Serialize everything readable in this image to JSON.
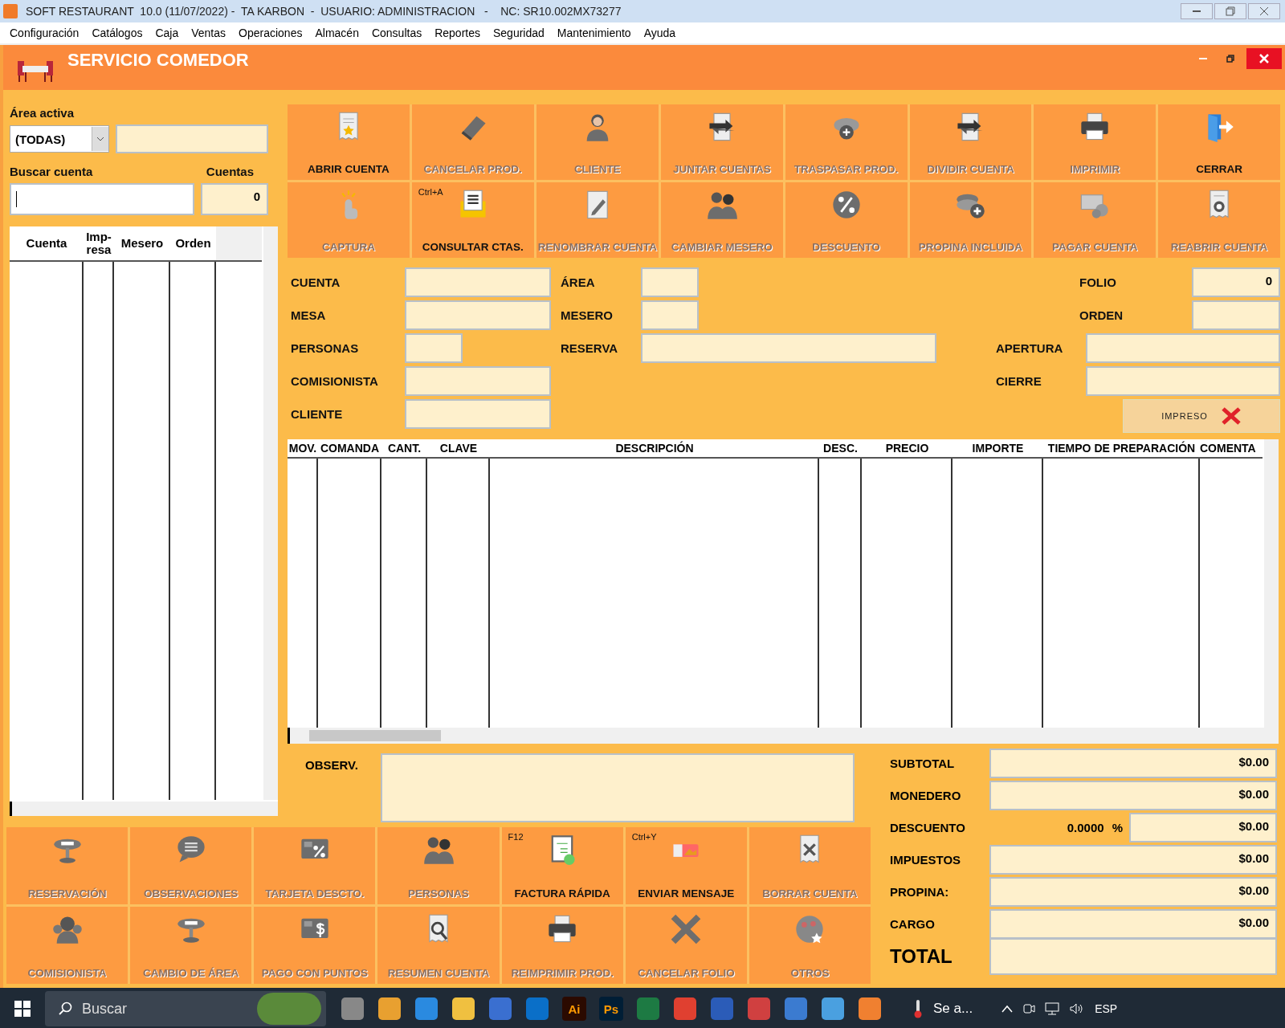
{
  "window": {
    "title": "SOFT RESTAURANT  10.0 (11/07/2022) -  TA KARBON  -  USUARIO: ADMINISTRACION   -    NC: SR10.002MX73277"
  },
  "menu": [
    "Configuración",
    "Catálogos",
    "Caja",
    "Ventas",
    "Operaciones",
    "Almacén",
    "Consultas",
    "Reportes",
    "Seguridad",
    "Mantenimiento",
    "Ayuda"
  ],
  "form_window": {
    "title": "SERVICIO COMEDOR"
  },
  "left_panel": {
    "area_label": "Área activa",
    "area_value": "(TODAS)",
    "search_label": "Buscar cuenta",
    "count_label": "Cuentas",
    "count_value": "0",
    "columns": [
      "Cuenta",
      "Imp-resa",
      "Mesero",
      "Orden"
    ]
  },
  "toolbar": [
    {
      "label": "ABRIR CUENTA",
      "disabled": false
    },
    {
      "label": "CANCELAR PROD.",
      "disabled": true
    },
    {
      "label": "CLIENTE",
      "disabled": true
    },
    {
      "label": "JUNTAR CUENTAS",
      "disabled": true
    },
    {
      "label": "TRASPASAR PROD.",
      "disabled": true
    },
    {
      "label": "DIVIDIR CUENTA",
      "disabled": true
    },
    {
      "label": "IMPRIMIR",
      "disabled": true
    },
    {
      "label": "CERRAR",
      "disabled": false
    },
    {
      "label": "CAPTURA",
      "disabled": true
    },
    {
      "label": "CONSULTAR CTAS.",
      "disabled": false,
      "shortcut": "Ctrl+A"
    },
    {
      "label": "RENOMBRAR CUENTA",
      "disabled": true
    },
    {
      "label": "CAMBIAR MESERO",
      "disabled": true
    },
    {
      "label": "DESCUENTO",
      "disabled": true
    },
    {
      "label": "PROPINA INCLUIDA",
      "disabled": true
    },
    {
      "label": "PAGAR CUENTA",
      "disabled": true
    },
    {
      "label": "REABRIR CUENTA",
      "disabled": true
    }
  ],
  "form": {
    "left_fields": [
      {
        "label": "CUENTA"
      },
      {
        "label": "MESA"
      },
      {
        "label": "PERSONAS"
      },
      {
        "label": "COMISIONISTA"
      },
      {
        "label": "CLIENTE"
      }
    ],
    "middle_fields": [
      {
        "label": "ÁREA"
      },
      {
        "label": "MESERO"
      },
      {
        "label": "RESERVA"
      }
    ],
    "right_fields": [
      {
        "label": "FOLIO",
        "value": "0"
      },
      {
        "label": "ORDEN"
      },
      {
        "label": "APERTURA"
      },
      {
        "label": "CIERRE"
      }
    ],
    "printed_button": {
      "label": "IMPRESO",
      "checked": false
    }
  },
  "table": {
    "columns": [
      "MOV.",
      "COMANDA",
      "CANT.",
      "CLAVE",
      "DESCRIPCIÓN",
      "DESC.",
      "PRECIO",
      "IMPORTE",
      "TIEMPO DE PREPARACIÓN",
      "COMENTA"
    ]
  },
  "observations": {
    "label": "OBSERV."
  },
  "totals": [
    {
      "label": "SUBTOTAL",
      "value": "$0.00"
    },
    {
      "label": "MONEDERO",
      "value": "$0.00"
    },
    {
      "label": "DESCUENTO",
      "value": "$0.00",
      "percent": "0.0000",
      "percent_sign": "%"
    },
    {
      "label": "IMPUESTOS",
      "value": "$0.00"
    },
    {
      "label": "PROPINA:",
      "value": "$0.00"
    },
    {
      "label": "CARGO",
      "value": "$0.00"
    },
    {
      "label": "TOTAL",
      "kind": "grand"
    }
  ],
  "bottom_buttons": [
    {
      "label": "RESERVACIÓN",
      "disabled": true
    },
    {
      "label": "OBSERVACIONES",
      "disabled": true
    },
    {
      "label": "TARJETA DESCTO.",
      "disabled": true
    },
    {
      "label": "PERSONAS",
      "disabled": true
    },
    {
      "label": "FACTURA RÁPIDA",
      "disabled": false,
      "shortcut": "F12"
    },
    {
      "label": "ENVIAR MENSAJE",
      "disabled": false,
      "shortcut": "Ctrl+Y"
    },
    {
      "label": "BORRAR CUENTA",
      "disabled": true
    },
    {
      "label": "COMISIONISTA",
      "disabled": true
    },
    {
      "label": "CAMBIO DE ÁREA",
      "disabled": true
    },
    {
      "label": "PAGO CON PUNTOS",
      "disabled": true
    },
    {
      "label": "RESUMEN CUENTA",
      "disabled": true
    },
    {
      "label": "REIMPRIMIR PROD.",
      "disabled": true
    },
    {
      "label": "CANCELAR FOLIO",
      "disabled": true
    },
    {
      "label": "OTROS",
      "disabled": true
    }
  ],
  "taskbar": {
    "search_placeholder": "Buscar",
    "apps": [
      {
        "kind": "icon"
      },
      {
        "kind": "icon"
      },
      {
        "kind": "icon"
      },
      {
        "kind": "icon"
      },
      {
        "kind": "icon"
      },
      {
        "kind": "icon"
      },
      {
        "kind": "text",
        "text": "Ai",
        "color": "#2b0a00"
      },
      {
        "kind": "text",
        "text": "Ps",
        "color": "#001e36"
      },
      {
        "kind": "icon"
      },
      {
        "kind": "icon"
      },
      {
        "kind": "icon"
      },
      {
        "kind": "icon"
      },
      {
        "kind": "icon"
      },
      {
        "kind": "icon"
      },
      {
        "kind": "icon"
      }
    ],
    "weather": "Se a...",
    "language": "ESP"
  }
}
